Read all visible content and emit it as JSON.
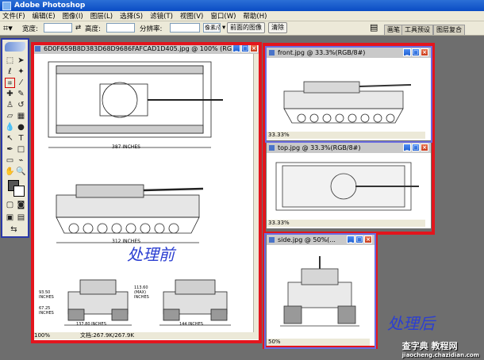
{
  "app": {
    "title": "Adobe Photoshop"
  },
  "menu": [
    "文件(F)",
    "编辑(E)",
    "图像(I)",
    "图层(L)",
    "选择(S)",
    "滤镜(T)",
    "视图(V)",
    "窗口(W)",
    "帮助(H)"
  ],
  "options": {
    "width_label": "宽度:",
    "height_label": "高度:",
    "resolution_label": "分辨率:",
    "unit_value": "像素/英寸",
    "front_image_button": "前面的图像",
    "clear_button": "清除",
    "palette_tabs": [
      "画笔",
      "工具预设",
      "图层复合"
    ]
  },
  "documents": {
    "main": {
      "title": "6D0F659B8D383D68D9686FAFCAD1D405.jpg @ 100% (RG...",
      "zoom": "100%",
      "doc_info": "文档:267.9K/267.9K"
    },
    "front": {
      "title": "front.jpg @ 33.3%(RGB/8#)",
      "zoom": "33.33%"
    },
    "top": {
      "title": "top.jpg @ 33.3%(RGB/8#)",
      "zoom": "33.33%"
    },
    "side": {
      "title": "side.jpg @ 50%(...",
      "zoom": "50%"
    }
  },
  "drawing_labels": {
    "dim_top": "387 INCHES",
    "dim_side": "312 INCHES",
    "dim_front_width": "137.80 INCHES",
    "dim_rear_width": "144 INCHES",
    "dim_height_max": "113.60 (MAX) INCHES",
    "dim_left_1": "93.50 INCHES",
    "dim_left_2": "67.25 INCHES"
  },
  "annotations": {
    "before": "处理前",
    "after": "处理后"
  },
  "watermark": {
    "main": "查字典 教程网",
    "sub": "jiaocheng.chazidian.com"
  },
  "colors": {
    "highlight_red": "#e3151d",
    "highlight_blue": "#6a6ce0",
    "workspace": "#6e6e6e"
  }
}
